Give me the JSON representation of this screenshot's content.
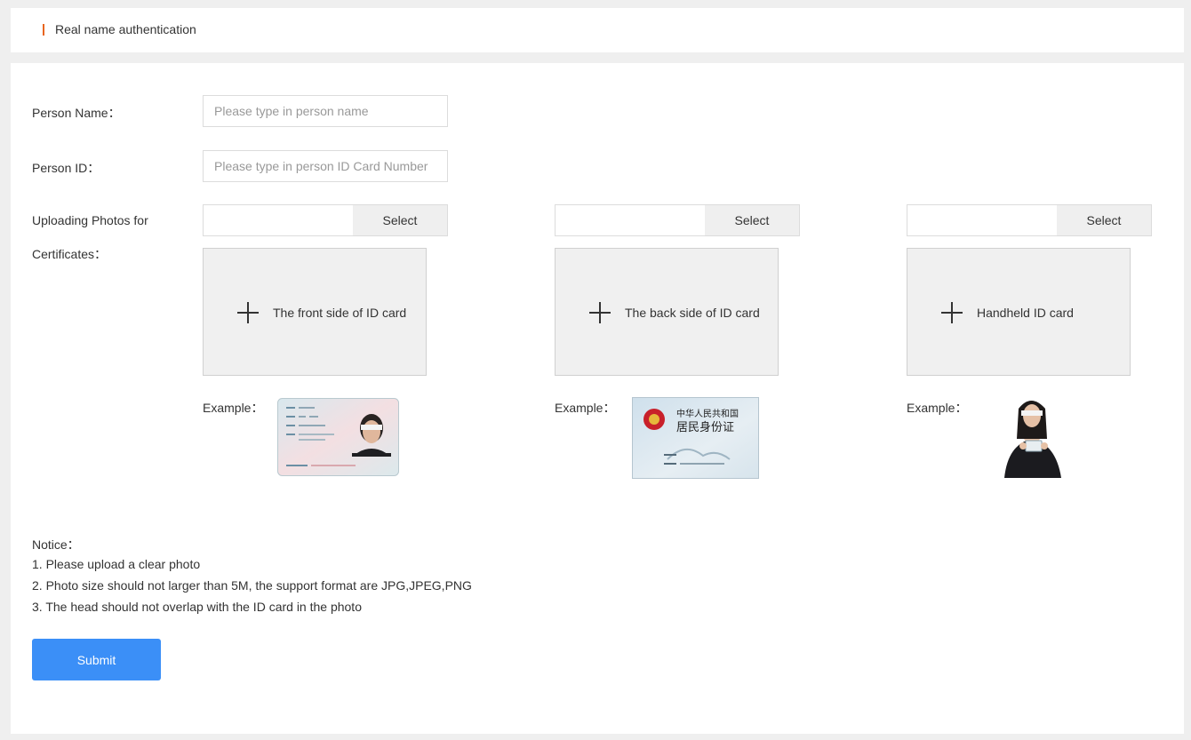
{
  "header": {
    "title": "Real name authentication"
  },
  "form": {
    "name_label": "Person Name：",
    "name_placeholder": "Please type in person name",
    "id_label": "Person ID：",
    "id_placeholder": "Please type in person ID Card Number",
    "photos_label_line1": "Uploading Photos for",
    "photos_label_line2": "Certificates："
  },
  "uploads": [
    {
      "select_label": "Select",
      "box_text": "The front side of ID card",
      "example_label": "Example："
    },
    {
      "select_label": "Select",
      "box_text": "The back side of ID card",
      "example_label": "Example："
    },
    {
      "select_label": "Select",
      "box_text": "Handheld ID card",
      "example_label": "Example："
    }
  ],
  "back_card_text": {
    "line1": "中华人民共和国",
    "line2": "居民身份证"
  },
  "notice": {
    "title": "Notice：",
    "items": [
      "1. Please upload a clear photo",
      "2. Photo size should not larger than 5M, the support format are JPG,JPEG,PNG",
      "3. The head should not overlap with the ID card in the photo"
    ]
  },
  "submit_label": "Submit",
  "colors": {
    "accent": "#e8651f",
    "primary": "#3b8ff7"
  }
}
